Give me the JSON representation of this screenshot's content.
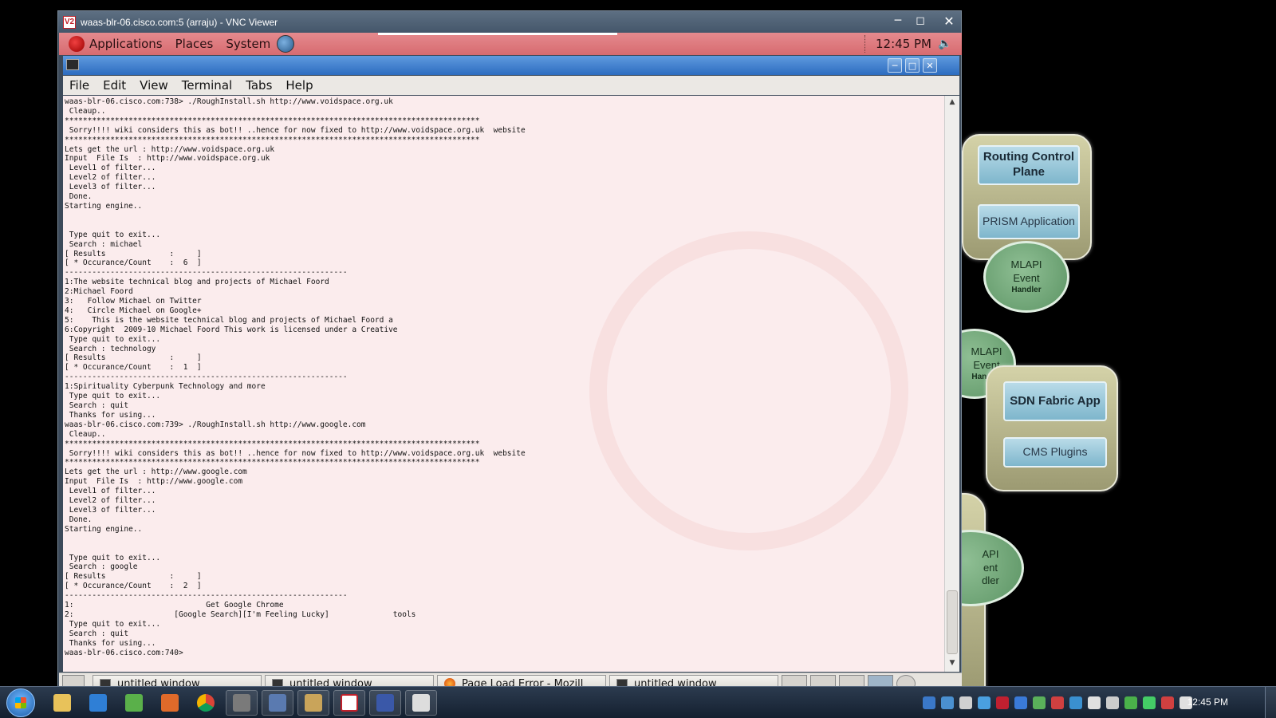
{
  "vnc": {
    "title": "waas-blr-06.cisco.com:5 (arraju) - VNC Viewer",
    "logo_text": "V2"
  },
  "gnome_panel": {
    "menus": [
      "Applications",
      "Places",
      "System"
    ],
    "clock": "12:45 PM"
  },
  "terminal": {
    "menubar": [
      "File",
      "Edit",
      "View",
      "Terminal",
      "Tabs",
      "Help"
    ],
    "lines": [
      "waas-blr-06.cisco.com:738> ./RoughInstall.sh http://www.voidspace.org.uk",
      " Cleaup..",
      "*******************************************************************************************",
      " Sorry!!!! wiki considers this as bot!! ..hence for now fixed to http://www.voidspace.org.uk  website",
      "*******************************************************************************************",
      "Lets get the url : http://www.voidspace.org.uk",
      "Input  File Is  : http://www.voidspace.org.uk",
      " Level1 of filter...",
      " Level2 of filter...",
      " Level3 of filter...",
      " Done.",
      "Starting engine..",
      "",
      "",
      " Type quit to exit...",
      " Search : michael",
      "[ Results              :     ]",
      "[ * Occurance/Count    :  6  ]",
      "--------------------------------------------------------------",
      "1:The website technical blog and projects of Michael Foord",
      "2:Michael Foord",
      "3:   Follow Michael on Twitter",
      "4:   Circle Michael on Google+",
      "5:    This is the website technical blog and projects of Michael Foord a",
      "6:Copyright  2009-10 Michael Foord This work is licensed under a Creative",
      " Type quit to exit...",
      " Search : technology",
      "[ Results              :     ]",
      "[ * Occurance/Count    :  1  ]",
      "--------------------------------------------------------------",
      "1:Spirituality Cyberpunk Technology and more",
      " Type quit to exit...",
      " Search : quit",
      " Thanks for using...",
      "waas-blr-06.cisco.com:739> ./RoughInstall.sh http://www.google.com",
      " Cleaup..",
      "*******************************************************************************************",
      " Sorry!!!! wiki considers this as bot!! ..hence for now fixed to http://www.voidspace.org.uk  website",
      "*******************************************************************************************",
      "Lets get the url : http://www.google.com",
      "Input  File Is  : http://www.google.com",
      " Level1 of filter...",
      " Level2 of filter...",
      " Level3 of filter...",
      " Done.",
      "Starting engine..",
      "",
      "",
      " Type quit to exit...",
      " Search : google",
      "[ Results              :     ]",
      "[ * Occurance/Count    :  2  ]",
      "--------------------------------------------------------------",
      "1:                             Get Google Chrome",
      "2:                      [Google Search][I'm Feeling Lucky]              tools",
      " Type quit to exit...",
      " Search : quit",
      " Thanks for using...",
      "waas-blr-06.cisco.com:740>"
    ]
  },
  "task_panel": {
    "buttons": [
      "untitled window",
      "untitled window",
      "Page Load Error - Mozill",
      "untitled window"
    ]
  },
  "diagram": {
    "routing": "Routing Control Plane",
    "prism": "PRISM Application",
    "mlapi1": [
      "MLAPI",
      "Event",
      "Handler"
    ],
    "mlapi2": [
      "MLAPI",
      "Event",
      "Handler"
    ],
    "sdn": "SDN Fabric App",
    "cms": "CMS Plugins",
    "mlapi3": [
      "API",
      "ent",
      "dler"
    ]
  },
  "windows_taskbar": {
    "clock": "12:45 PM",
    "pinned": [
      "explorer",
      "internet-explorer",
      "network",
      "media-player",
      "chrome",
      "tool",
      "monitor",
      "folder",
      "vnc-viewer",
      "screen",
      "chat"
    ],
    "tray": [
      "outlook",
      "shield",
      "cisco",
      "network",
      "lock",
      "bluetooth",
      "app",
      "app",
      "app",
      "flag",
      "signal",
      "globe",
      "sync",
      "mute",
      "power"
    ]
  }
}
